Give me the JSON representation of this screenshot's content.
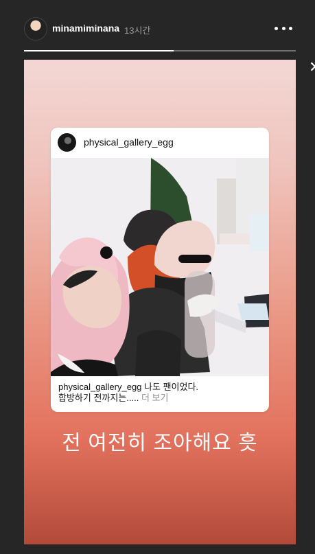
{
  "header": {
    "username": "minamiminana",
    "time": "13시간",
    "progress": 0.55
  },
  "post": {
    "username": "physical_gallery_egg",
    "caption_user": "physical_gallery_egg",
    "caption_text": " 나도 팬이었다.",
    "caption_line2": "합방하기 전까지는.....",
    "more_label": " 더 보기"
  },
  "story": {
    "text": "전 여전히 조아해요 흣"
  }
}
